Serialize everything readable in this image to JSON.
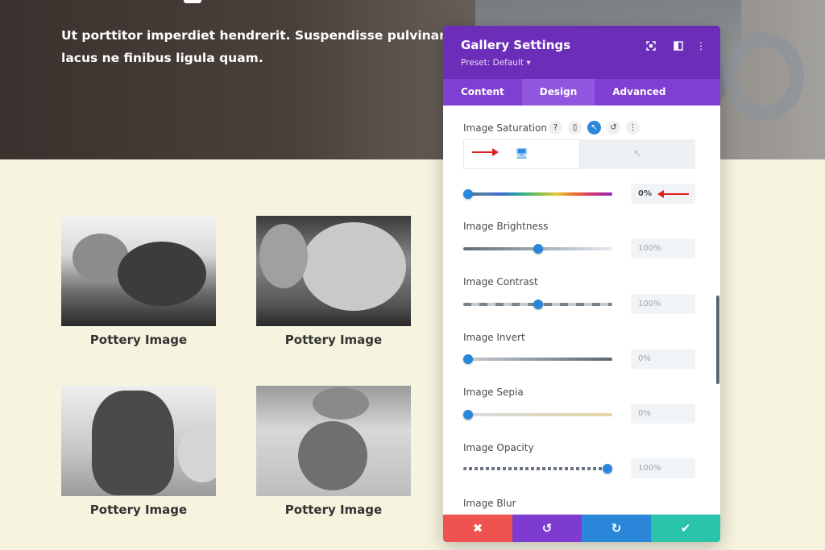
{
  "hero": {
    "text": "Ut porttitor imperdiet hendrerit. Suspendisse pulvinar lacus ne finibus ligula quam."
  },
  "gallery": {
    "items": [
      {
        "caption": "Pottery Image"
      },
      {
        "caption": "Pottery Image"
      },
      {
        "caption": "Pottery Image"
      },
      {
        "caption": "Pottery Image"
      }
    ]
  },
  "panel": {
    "title": "Gallery Settings",
    "preset": "Preset: Default",
    "preset_caret": "▾",
    "header_icons": [
      "focus-icon",
      "split-view-icon",
      "more-icon"
    ],
    "tabs": [
      {
        "label": "Content",
        "active": false
      },
      {
        "label": "Design",
        "active": true
      },
      {
        "label": "Advanced",
        "active": false
      }
    ],
    "options": [
      {
        "label": "Image Saturation",
        "value": "0%",
        "level": 0.0
      },
      {
        "label": "Image Brightness",
        "value": "100%",
        "level": 0.5
      },
      {
        "label": "Image Contrast",
        "value": "100%",
        "level": 0.5
      },
      {
        "label": "Image Invert",
        "value": "0%",
        "level": 0.0
      },
      {
        "label": "Image Sepia",
        "value": "0%",
        "level": 0.0
      },
      {
        "label": "Image Opacity",
        "value": "100%",
        "level": 1.0
      },
      {
        "label": "Image Blur"
      }
    ],
    "saturation_icons": {
      "help": "?",
      "phone": "▯",
      "cursor": "↖",
      "reset": "↺",
      "more": "⋮"
    },
    "device_tabs": {
      "desktop": "🖥",
      "hover": "↖"
    },
    "footer": {
      "cancel": "✖",
      "undo": "↺",
      "redo": "↻",
      "save": "✔"
    }
  },
  "colors": {
    "purple_dark": "#6c2eb9",
    "purple": "#7f3fd1",
    "accent_blue": "#2b87da",
    "cancel_red": "#ef5350",
    "undo_purple": "#7e3bd0",
    "redo_blue": "#2b87da",
    "save_green": "#29c4a9"
  }
}
